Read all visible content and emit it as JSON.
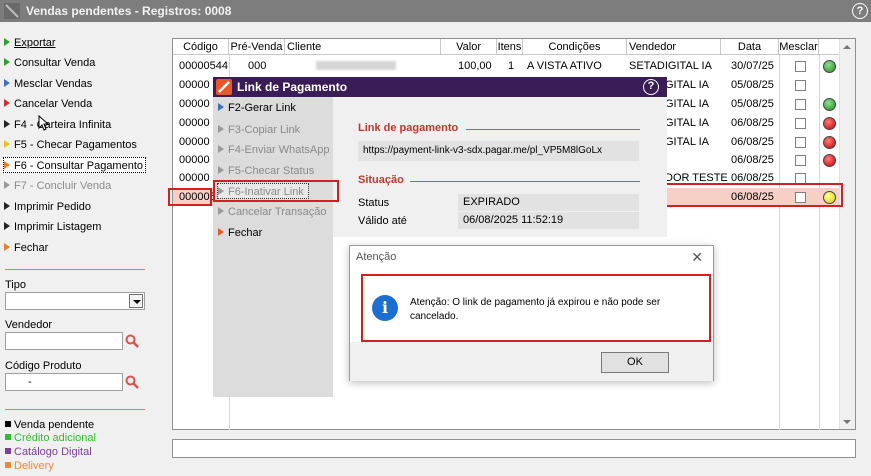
{
  "window": {
    "title": "Vendas pendentes - Registros: 0008",
    "help": "?"
  },
  "sidebar": {
    "items": [
      {
        "label": "Exportar",
        "color": "green"
      },
      {
        "label": "Consultar Venda",
        "color": "green"
      },
      {
        "label": "Mesclar Vendas",
        "color": "blue"
      },
      {
        "label": "Cancelar Venda",
        "color": "red"
      },
      {
        "label": "F4 - Carteira Infinita",
        "color": "dark"
      },
      {
        "label": "F5 - Checar Pagamentos",
        "color": "yellow"
      },
      {
        "label": "F6 - Consultar Pagamento",
        "color": "orange"
      },
      {
        "label": "F7 - Concluir Venda",
        "color": "gray"
      },
      {
        "label": "Imprimir Pedido",
        "color": "dark"
      },
      {
        "label": "Imprimir Listagem",
        "color": "dark"
      },
      {
        "label": "Fechar",
        "color": "orange"
      }
    ],
    "tipo_label": "Tipo",
    "vendedor_label": "Vendedor",
    "codigo_produto_label": "Código Produto",
    "codigo_produto_value": "-",
    "legend": [
      {
        "label": "Venda pendente",
        "color": "#000000"
      },
      {
        "label": "Crédito adicional",
        "color": "#2bbf2b"
      },
      {
        "label": "Catálogo Digital",
        "color": "#7b3fa0"
      },
      {
        "label": "Delivery",
        "color": "#f0883a"
      }
    ]
  },
  "grid": {
    "columns": [
      "Código",
      "Pré-Venda",
      "Cliente",
      "Valor",
      "Itens",
      "Condições",
      "Vendedor",
      "Data",
      "Mesclar"
    ],
    "rows": [
      {
        "codigo": "00000544",
        "prevenda": "000",
        "valor": "100,00",
        "itens": "1",
        "condicoes": "A VISTA ATIVO",
        "vendedor": "SETADIGITAL IA",
        "data": "30/07/25",
        "status": "green"
      },
      {
        "codigo": "00000",
        "prevenda": "",
        "valor": "",
        "itens": "",
        "condicoes": "",
        "vendedor": "GITAL IA",
        "data": "05/08/25",
        "status": ""
      },
      {
        "codigo": "00000",
        "prevenda": "",
        "valor": "",
        "itens": "",
        "condicoes": "",
        "vendedor": "GITAL IA",
        "data": "05/08/25",
        "status": "green"
      },
      {
        "codigo": "00000",
        "prevenda": "",
        "valor": "",
        "itens": "",
        "condicoes": "",
        "vendedor": "GITAL IA",
        "data": "06/08/25",
        "status": "red"
      },
      {
        "codigo": "00000",
        "prevenda": "",
        "valor": "",
        "itens": "",
        "condicoes": "",
        "vendedor": "GITAL IA",
        "data": "06/08/25",
        "status": "red"
      },
      {
        "codigo": "00000",
        "prevenda": "",
        "valor": "",
        "itens": "",
        "condicoes": "",
        "vendedor": "",
        "data": "06/08/25",
        "status": "red"
      },
      {
        "codigo": "00000",
        "prevenda": "",
        "valor": "",
        "itens": "",
        "condicoes": "",
        "vendedor": "DOR TESTE",
        "data": "06/08/25",
        "status": ""
      },
      {
        "codigo": "000005",
        "prevenda": "",
        "valor": "",
        "itens": "",
        "condicoes": "",
        "vendedor": "",
        "data": "06/08/25",
        "status": "yellow"
      }
    ]
  },
  "payment_dialog": {
    "title": "Link de Pagamento",
    "menu": [
      {
        "label": "F2-Gerar Link",
        "disabled": false
      },
      {
        "label": "F3-Copiar Link",
        "disabled": true
      },
      {
        "label": "F4-Enviar WhatsApp",
        "disabled": true
      },
      {
        "label": "F5-Checar Status",
        "disabled": true
      },
      {
        "label": "F6-Inativar Link",
        "disabled": true
      },
      {
        "label": "Cancelar Transação",
        "disabled": true
      },
      {
        "label": "Fechar",
        "disabled": false
      }
    ],
    "link_section": "Link de pagamento",
    "link_url": "https://payment-link-v3-sdx.pagar.me/pl_VP5M8lGoLx",
    "situacao_section": "Situação",
    "status_label": "Status",
    "status_value": "EXPIRADO",
    "valido_label": "Válido até",
    "valido_value": "06/08/2025 11:52:19"
  },
  "alert_dialog": {
    "title": "Atenção",
    "message": "Atenção: O link de pagamento já expirou e não pode ser cancelado.",
    "ok_label": "OK"
  }
}
